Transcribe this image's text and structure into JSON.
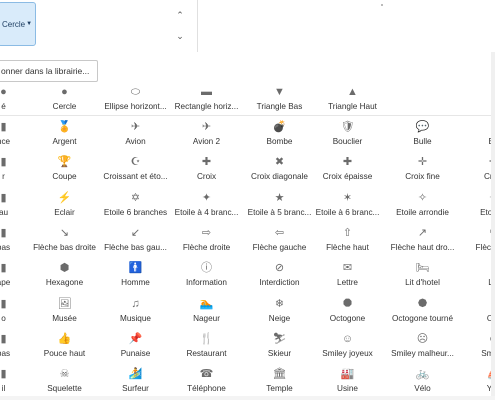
{
  "toolbar": {
    "shape_button_label": "Cercle",
    "scroll_up": "⌃",
    "scroll_down": "⌄"
  },
  "library_link": "onner dans la librairie...",
  "basic_shapes": [
    {
      "icon": "●",
      "name": "circle-icon",
      "label": "é"
    },
    {
      "icon": "●",
      "name": "circle-icon",
      "label": "Cercle"
    },
    {
      "icon": "⬭",
      "name": "ellipse-icon",
      "label": "Ellipse horizont..."
    },
    {
      "icon": "▬",
      "name": "rectangle-icon",
      "label": "Rectangle horiz..."
    },
    {
      "icon": "▼",
      "name": "triangle-down-icon",
      "label": "Triangle Bas"
    },
    {
      "icon": "▲",
      "name": "triangle-up-icon",
      "label": "Triangle Haut"
    }
  ],
  "symbol_rows": [
    [
      {
        "icon": "▮",
        "name": "partial-icon",
        "label": "nce"
      },
      {
        "icon": "🏅",
        "name": "medal-icon",
        "label": "Argent"
      },
      {
        "icon": "✈",
        "name": "plane-icon",
        "label": "Avion"
      },
      {
        "icon": "✈",
        "name": "plane2-icon",
        "label": "Avion 2"
      },
      {
        "icon": "💣",
        "name": "bomb-icon",
        "label": "Bombe"
      },
      {
        "icon": "🛡",
        "name": "shield-icon",
        "label": "Bouclier"
      },
      {
        "icon": "💬",
        "name": "bubble-icon",
        "label": "Bulle"
      },
      {
        "icon": "▯",
        "name": "partial-icon",
        "label": "Bu"
      }
    ],
    [
      {
        "icon": "▮",
        "name": "partial-icon",
        "label": "r"
      },
      {
        "icon": "🏆",
        "name": "cup-icon",
        "label": "Coupe"
      },
      {
        "icon": "☪",
        "name": "crescent-icon",
        "label": "Croissant et éto..."
      },
      {
        "icon": "✚",
        "name": "cross-icon",
        "label": "Croix"
      },
      {
        "icon": "✖",
        "name": "diagonal-cross-icon",
        "label": "Croix diagonale"
      },
      {
        "icon": "✚",
        "name": "thick-cross-icon",
        "label": "Croix épaisse"
      },
      {
        "icon": "✛",
        "name": "thin-cross-icon",
        "label": "Croix fine"
      },
      {
        "icon": "✛",
        "name": "partial-icon",
        "label": "Croix"
      }
    ],
    [
      {
        "icon": "▮",
        "name": "partial-icon",
        "label": "au"
      },
      {
        "icon": "⚡",
        "name": "lightning-icon",
        "label": "Eclair"
      },
      {
        "icon": "✡",
        "name": "six-point-star-icon",
        "label": "Etoile 6 branches"
      },
      {
        "icon": "✦",
        "name": "four-point-star-icon",
        "label": "Etoile à 4 branc..."
      },
      {
        "icon": "★",
        "name": "five-point-star-icon",
        "label": "Etoile à 5 branc..."
      },
      {
        "icon": "✶",
        "name": "six-branch-star-icon",
        "label": "Etoile à 6 branc..."
      },
      {
        "icon": "✧",
        "name": "rounded-star-icon",
        "label": "Etoile arrondie"
      },
      {
        "icon": "✦",
        "name": "partial-icon",
        "label": "Etoile s"
      }
    ],
    [
      {
        "icon": "▮",
        "name": "partial-icon",
        "label": "bas"
      },
      {
        "icon": "↘",
        "name": "arrow-down-right-icon",
        "label": "Flèche bas droite"
      },
      {
        "icon": "↙",
        "name": "arrow-down-left-icon",
        "label": "Flèche bas gau..."
      },
      {
        "icon": "⇨",
        "name": "arrow-right-icon",
        "label": "Flèche droite"
      },
      {
        "icon": "⇦",
        "name": "arrow-left-icon",
        "label": "Flèche gauche"
      },
      {
        "icon": "⇧",
        "name": "arrow-up-icon",
        "label": "Flèche haut"
      },
      {
        "icon": "↗",
        "name": "arrow-up-right-icon",
        "label": "Flèche haut dro..."
      },
      {
        "icon": "↖",
        "name": "partial-icon",
        "label": "Flèche ha"
      }
    ],
    [
      {
        "icon": "▮",
        "name": "partial-icon",
        "label": "ape"
      },
      {
        "icon": "⬢",
        "name": "hexagon-icon",
        "label": "Hexagone"
      },
      {
        "icon": "🚹",
        "name": "man-icon",
        "label": "Homme"
      },
      {
        "icon": "ⓘ",
        "name": "info-icon",
        "label": "Information"
      },
      {
        "icon": "⊘",
        "name": "forbidden-icon",
        "label": "Interdiction"
      },
      {
        "icon": "✉",
        "name": "letter-icon",
        "label": "Lettre"
      },
      {
        "icon": "🛏",
        "name": "hotel-bed-icon",
        "label": "Lit d'hotel"
      },
      {
        "icon": "▮",
        "name": "partial-icon",
        "label": "Liv"
      }
    ],
    [
      {
        "icon": "▮",
        "name": "partial-icon",
        "label": "o"
      },
      {
        "icon": "🖼",
        "name": "museum-icon",
        "label": "Musée"
      },
      {
        "icon": "♫",
        "name": "music-icon",
        "label": "Musique"
      },
      {
        "icon": "🏊",
        "name": "swimmer-icon",
        "label": "Nageur"
      },
      {
        "icon": "❄",
        "name": "snow-icon",
        "label": "Neige"
      },
      {
        "icon": "⯃",
        "name": "octagon-icon",
        "label": "Octogone"
      },
      {
        "icon": "⯄",
        "name": "rotated-octagon-icon",
        "label": "Octogone tourné"
      },
      {
        "icon": "▮",
        "name": "partial-icon",
        "label": "Out"
      }
    ],
    [
      {
        "icon": "▮",
        "name": "partial-icon",
        "label": "bas"
      },
      {
        "icon": "👍",
        "name": "thumb-up-icon",
        "label": "Pouce haut"
      },
      {
        "icon": "📌",
        "name": "pin-icon",
        "label": "Punaise"
      },
      {
        "icon": "🍴",
        "name": "restaurant-icon",
        "label": "Restaurant"
      },
      {
        "icon": "⛷",
        "name": "skier-icon",
        "label": "Skieur"
      },
      {
        "icon": "☺",
        "name": "smiley-happy-icon",
        "label": "Smiley joyeux"
      },
      {
        "icon": "☹",
        "name": "smiley-sad-icon",
        "label": "Smiley malheur..."
      },
      {
        "icon": "☻",
        "name": "partial-icon",
        "label": "Smiley"
      }
    ],
    [
      {
        "icon": "▮",
        "name": "partial-icon",
        "label": "il"
      },
      {
        "icon": "☠",
        "name": "skeleton-icon",
        "label": "Squelette"
      },
      {
        "icon": "🏄",
        "name": "surfer-icon",
        "label": "Surfeur"
      },
      {
        "icon": "☎",
        "name": "telephone-icon",
        "label": "Téléphone"
      },
      {
        "icon": "🏛",
        "name": "temple-icon",
        "label": "Temple"
      },
      {
        "icon": "🏭",
        "name": "factory-icon",
        "label": "Usine"
      },
      {
        "icon": "🚲",
        "name": "bike-icon",
        "label": "Vélo"
      },
      {
        "icon": "⛵",
        "name": "partial-icon",
        "label": "Yac"
      }
    ]
  ]
}
